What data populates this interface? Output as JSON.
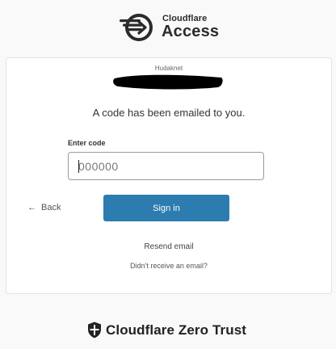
{
  "header": {
    "brand_small": "Cloudflare",
    "brand_large": "Access",
    "logo_icon": "cloudflare-access-arrow-icon"
  },
  "card": {
    "org_name": "Hudaknet",
    "message": "A code has been emailed to you.",
    "code_label": "Enter code",
    "code_placeholder": "000000",
    "back_label": "Back",
    "back_icon": "arrow-left-icon",
    "signin_label": "Sign in",
    "resend_label": "Resend email",
    "no_email_label": "Didn't receive an email?"
  },
  "footer": {
    "brand": "Cloudflare Zero Trust",
    "icon": "shield-icon"
  },
  "colors": {
    "page_background": "#f9f9f9",
    "card_background": "#ffffff",
    "primary_button": "#2c7cb0",
    "redaction": "#000000"
  }
}
